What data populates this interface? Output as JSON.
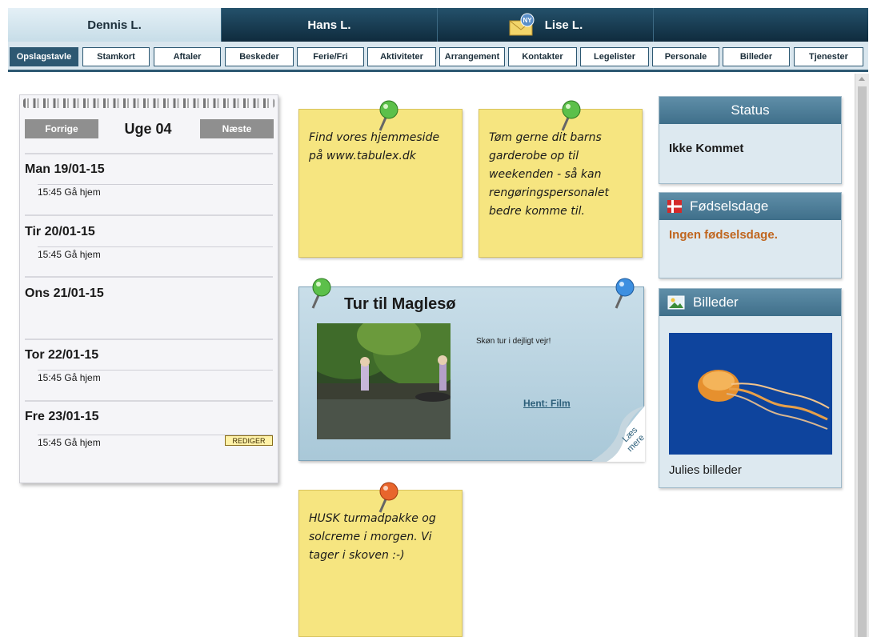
{
  "children_tabs": [
    {
      "name": "Dennis L.",
      "active": true
    },
    {
      "name": "Hans L.",
      "active": false
    },
    {
      "name": "Lise L.",
      "active": false,
      "badge": "NY"
    }
  ],
  "nav": [
    "Opslagstavle",
    "Stamkort",
    "Aftaler",
    "Beskeder",
    "Ferie/Fri",
    "Aktiviteter",
    "Arrangement",
    "Kontakter",
    "Legelister",
    "Personale",
    "Billeder",
    "Tjenester"
  ],
  "calendar": {
    "prev_label": "Forrige",
    "next_label": "Næste",
    "week_title": "Uge 04",
    "days": [
      {
        "date": "Man 19/01-15",
        "entry": "15:45 Gå hjem"
      },
      {
        "date": "Tir 20/01-15",
        "entry": "15:45 Gå hjem"
      },
      {
        "date": "Ons 21/01-15",
        "entry": ""
      },
      {
        "date": "Tor 22/01-15",
        "entry": "15:45 Gå hjem"
      },
      {
        "date": "Fre 23/01-15",
        "entry": "15:45 Gå hjem"
      }
    ],
    "edit_label": "REDIGER"
  },
  "notes": {
    "note1": "Find vores hjemmeside på www.tabulex.dk",
    "note2": "Tøm gerne dit barns garderobe op til weekenden - så kan rengøringspersonalet bedre komme til.",
    "note3": "HUSK turmadpakke og solcreme i morgen. Vi tager i skoven :-)"
  },
  "album": {
    "title": "Tur til Maglesø",
    "caption": "Skøn tur i dejligt vejr!",
    "link": "Hent: Film",
    "curl_label_1": "Læs",
    "curl_label_2": "mere"
  },
  "status": {
    "title": "Status",
    "value": "Ikke Kommet"
  },
  "birthdays": {
    "title": "Fødselsdage",
    "value": "Ingen fødselsdage."
  },
  "pictures": {
    "title": "Billeder",
    "caption": "Julies billeder"
  },
  "colors": {
    "nav_dark": "#2d5872",
    "note_yellow": "#f6e580",
    "birthday_text": "#c0661f"
  }
}
